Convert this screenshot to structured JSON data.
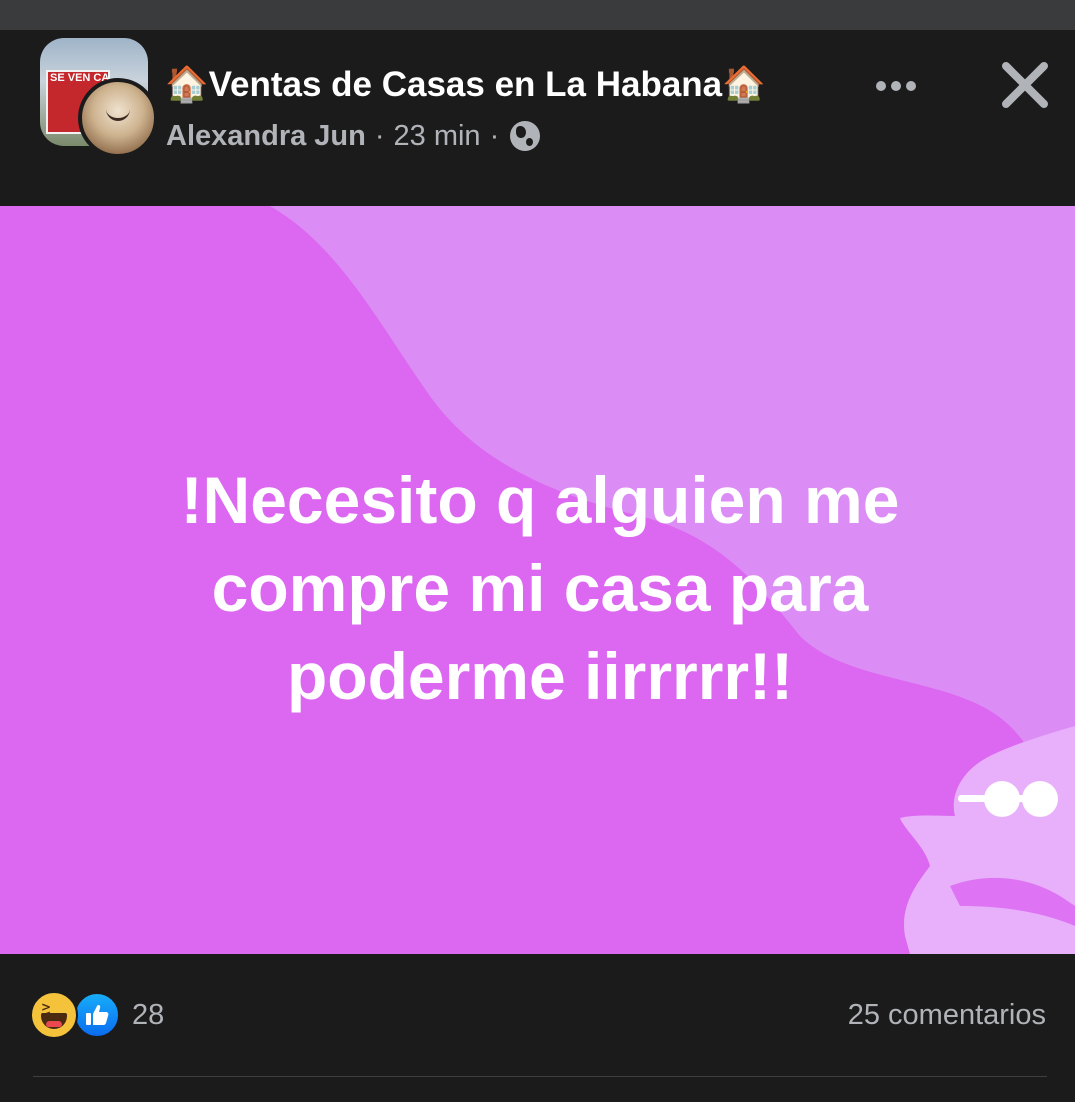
{
  "post": {
    "group_name": "🏠Ventas de Casas en La Habana🏠",
    "author": "Alexandra Jun",
    "time": "23 min",
    "separator": "·",
    "privacy_icon": "globe-icon",
    "body_text": "!Necesito q alguien me compre mi casa para poderme iirrrrr!!",
    "background_color": "#dc68f1",
    "accent_color": "#e6a0f8"
  },
  "group_avatar": {
    "sign_text": "SE VEN CA"
  },
  "footer": {
    "reactions": [
      "haha",
      "like"
    ],
    "reaction_count": "28",
    "comments": "25 comentarios"
  },
  "colors": {
    "page_bg": "#1b1b1b",
    "secondary_text": "#b0b3b8",
    "like_blue": "#0a6cf0",
    "haha_yellow": "#f5c33b"
  }
}
